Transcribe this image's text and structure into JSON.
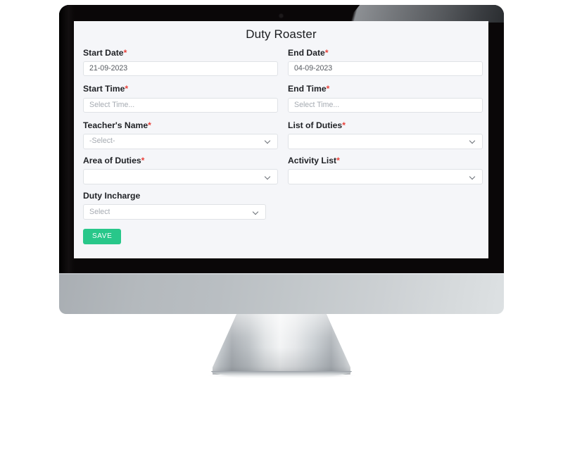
{
  "device": {
    "type": "desktop-monitor",
    "camera_icon": "camera-dot-icon"
  },
  "page": {
    "title": "Duty Roaster",
    "required_marker": "*",
    "accent_color": "#28c78a",
    "required_color": "#e8413a",
    "background_color": "#f5f6f9"
  },
  "form": {
    "rows": [
      {
        "left": {
          "label": "Start Date",
          "required": true,
          "control": "text",
          "value": "21-09-2023",
          "placeholder": "",
          "is_placeholder": false
        },
        "right": {
          "label": "End Date",
          "required": true,
          "control": "text",
          "value": "04-09-2023",
          "placeholder": "",
          "is_placeholder": false
        }
      },
      {
        "left": {
          "label": "Start Time",
          "required": true,
          "control": "text",
          "value": "Select Time...",
          "placeholder": "Select Time...",
          "is_placeholder": true
        },
        "right": {
          "label": "End Time",
          "required": true,
          "control": "text",
          "value": "Select Time...",
          "placeholder": "Select Time...",
          "is_placeholder": true
        }
      },
      {
        "left": {
          "label": "Teacher's Name",
          "required": true,
          "control": "select",
          "value": "-Select-",
          "is_placeholder": true
        },
        "right": {
          "label": "List of Duties",
          "required": true,
          "control": "select",
          "value": "",
          "is_placeholder": true
        }
      },
      {
        "left": {
          "label": "Area of Duties",
          "required": true,
          "control": "select",
          "value": "",
          "is_placeholder": true
        },
        "right": {
          "label": "Activity List",
          "required": true,
          "control": "select",
          "value": "",
          "is_placeholder": true
        }
      }
    ],
    "duty_incharge": {
      "label": "Duty Incharge",
      "required": false,
      "control": "select",
      "value": "Select",
      "is_placeholder": true
    },
    "save_label": "SAVE"
  }
}
